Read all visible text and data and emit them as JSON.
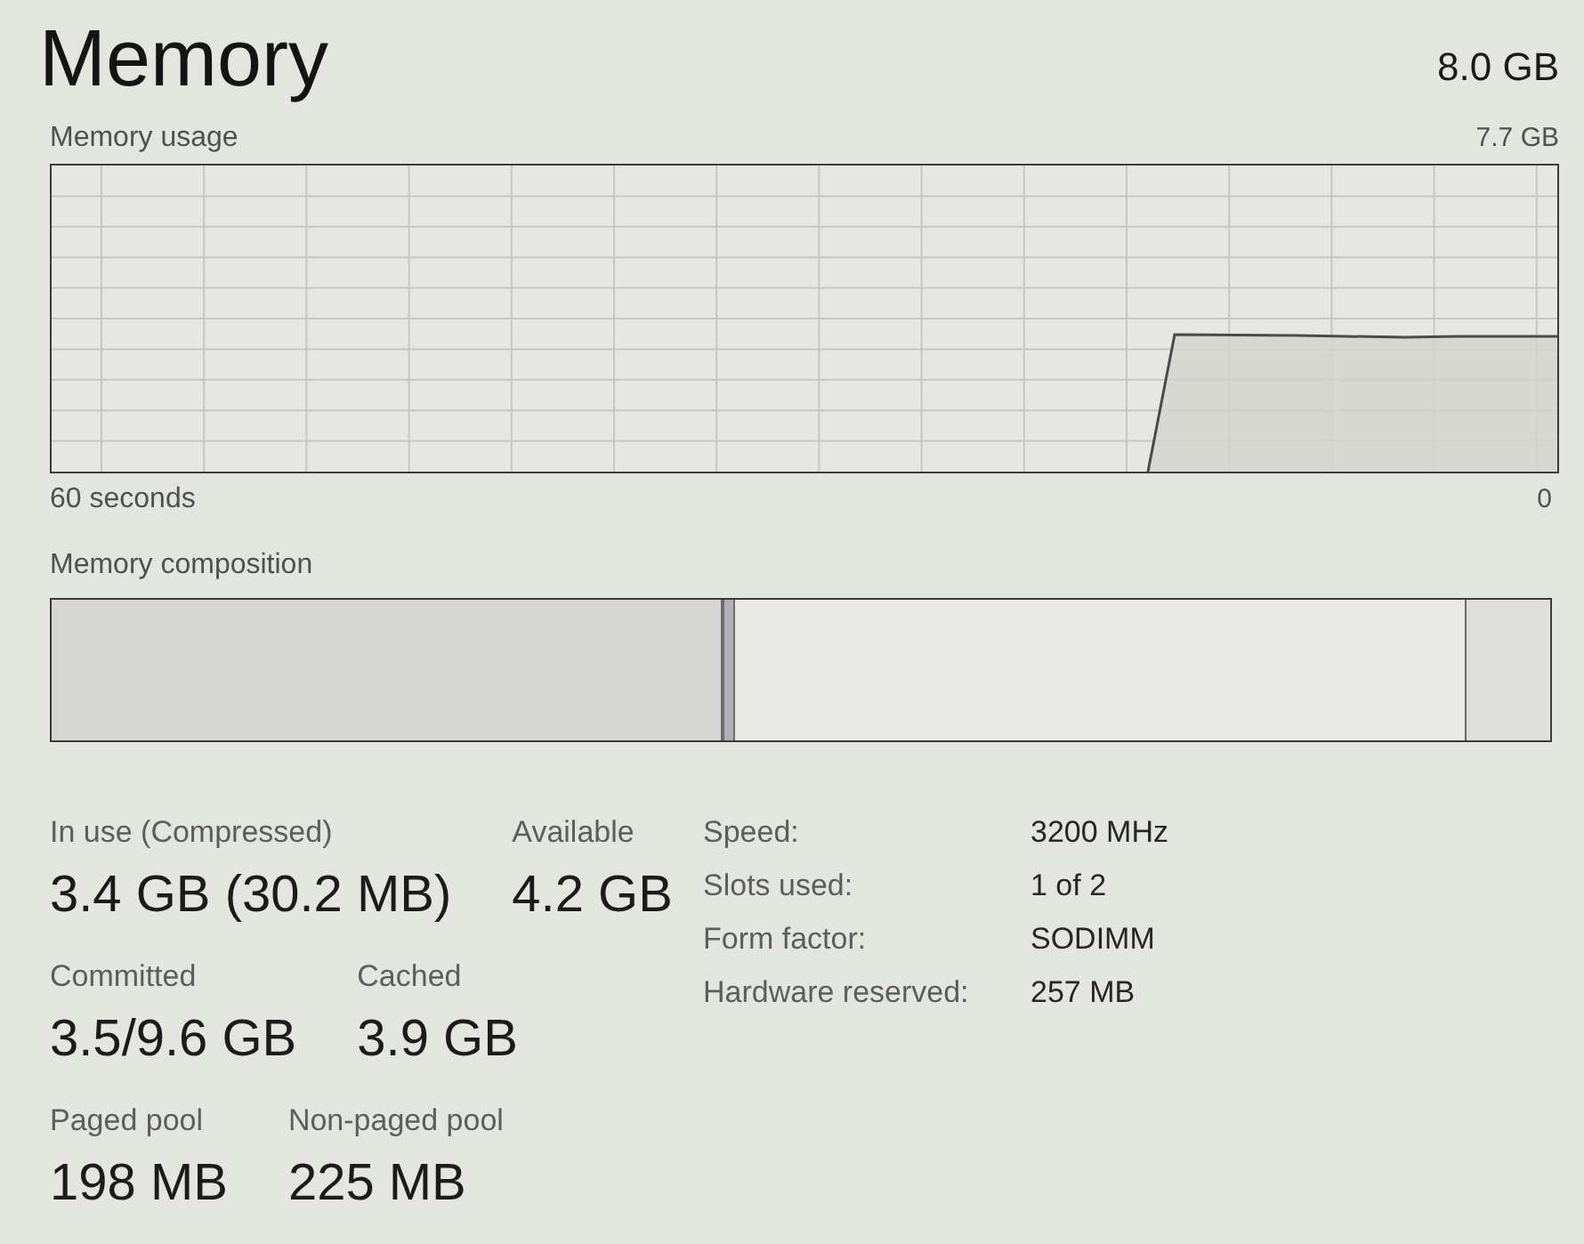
{
  "header": {
    "title": "Memory",
    "capacity": "8.0 GB"
  },
  "usage_graph": {
    "label": "Memory usage",
    "max_label": "7.7 GB",
    "time_span": "60 seconds",
    "end_label": "0"
  },
  "composition": {
    "label": "Memory composition"
  },
  "stat_rows": [
    {
      "items": [
        {
          "label": "In use (Compressed)",
          "value": "3.4 GB (30.2 MB)"
        },
        {
          "label": "Available",
          "value": "4.2 GB"
        }
      ]
    },
    {
      "items": [
        {
          "label": "Committed",
          "value": "3.5/9.6 GB"
        },
        {
          "label": "Cached",
          "value": "3.9 GB"
        }
      ]
    },
    {
      "items": [
        {
          "label": "Paged pool",
          "value": "198 MB"
        },
        {
          "label": "Non-paged pool",
          "value": "225 MB"
        }
      ]
    }
  ],
  "details": [
    {
      "label": "Speed:",
      "value": "3200 MHz"
    },
    {
      "label": "Slots used:",
      "value": "1 of 2"
    },
    {
      "label": "Form factor:",
      "value": "SODIMM"
    },
    {
      "label": "Hardware reserved:",
      "value": "257 MB"
    }
  ]
}
